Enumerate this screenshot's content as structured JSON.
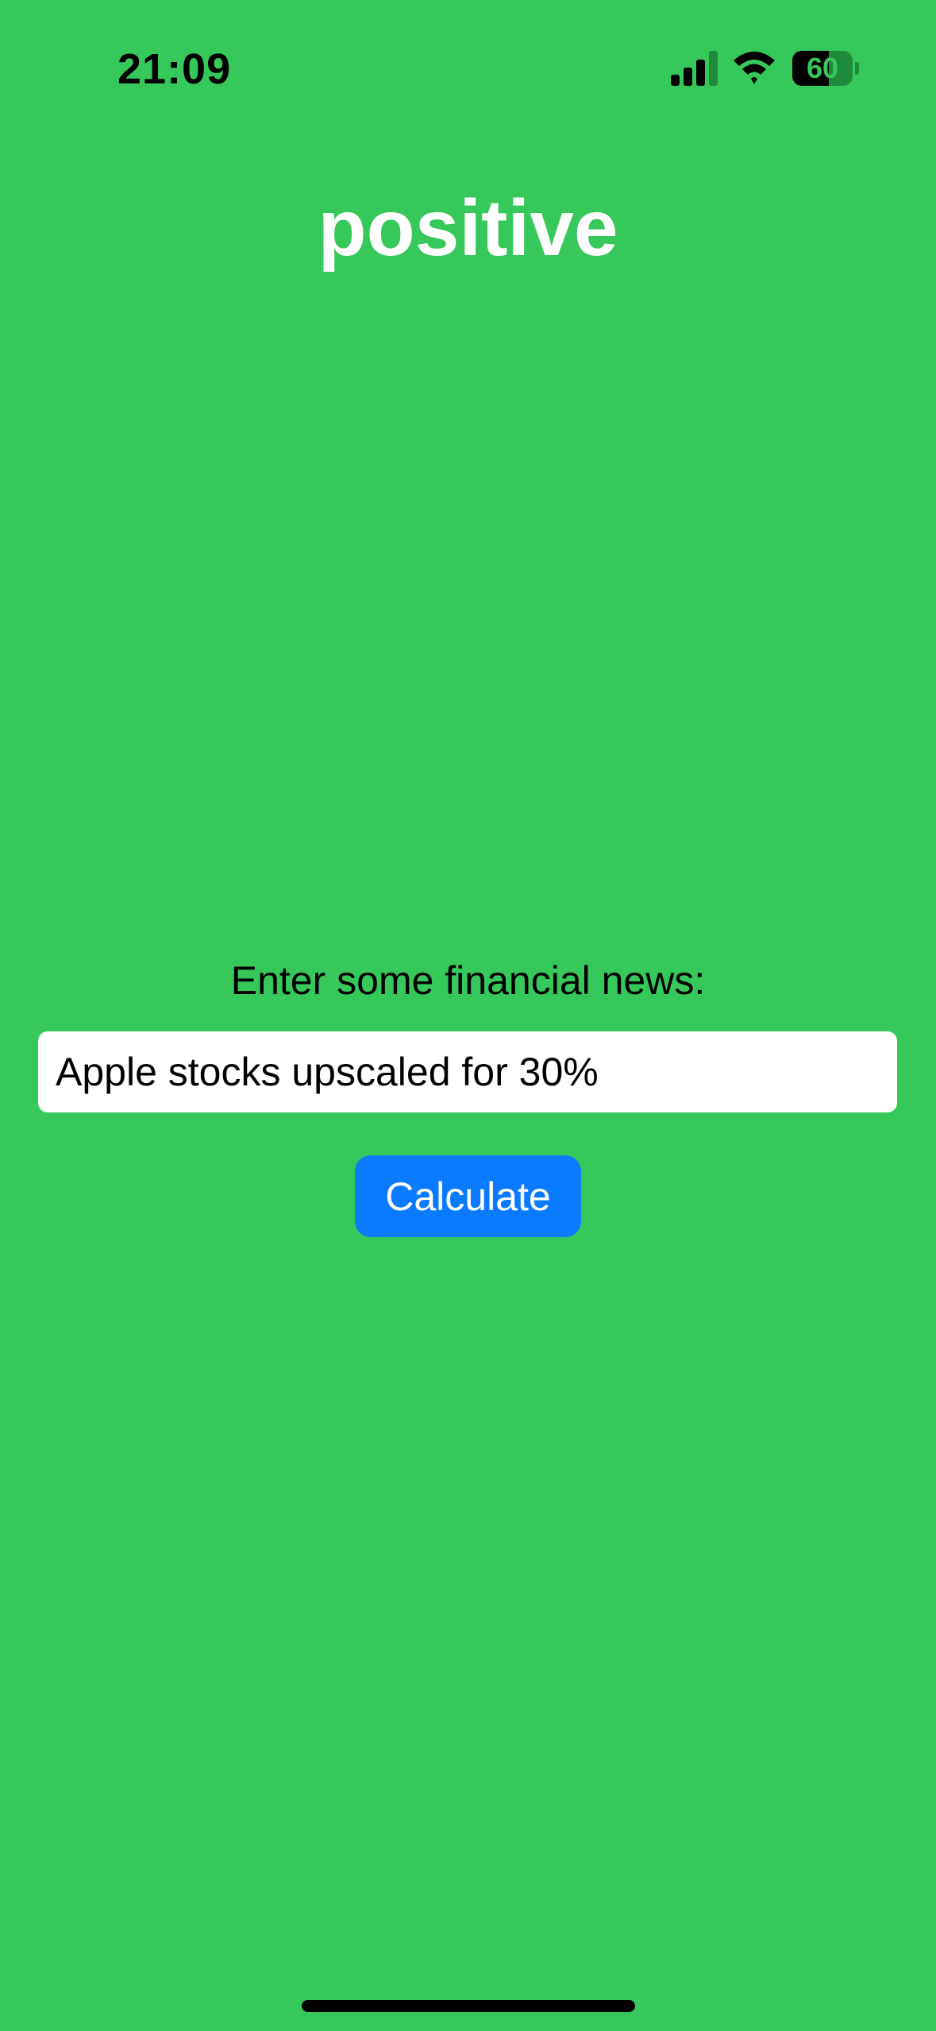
{
  "status_bar": {
    "time": "21:09",
    "battery_level": "60",
    "battery_fraction": 0.6,
    "signal_bars_active": 3,
    "signal_bars_total": 4,
    "signal_icon": "cellular-signal-icon",
    "wifi_icon": "wifi-icon",
    "battery_icon": "battery-icon"
  },
  "result": {
    "label": "positive"
  },
  "form": {
    "prompt": "Enter some financial news:",
    "input_value": "Apple stocks upscaled for 30%",
    "button_label": "Calculate"
  },
  "colors": {
    "background": "#36C85B",
    "title_text": "#FFFFFF",
    "button_background": "#0A7AFF",
    "button_text": "#FFFFFF",
    "input_background": "#FFFFFF",
    "status_text": "#000000"
  }
}
